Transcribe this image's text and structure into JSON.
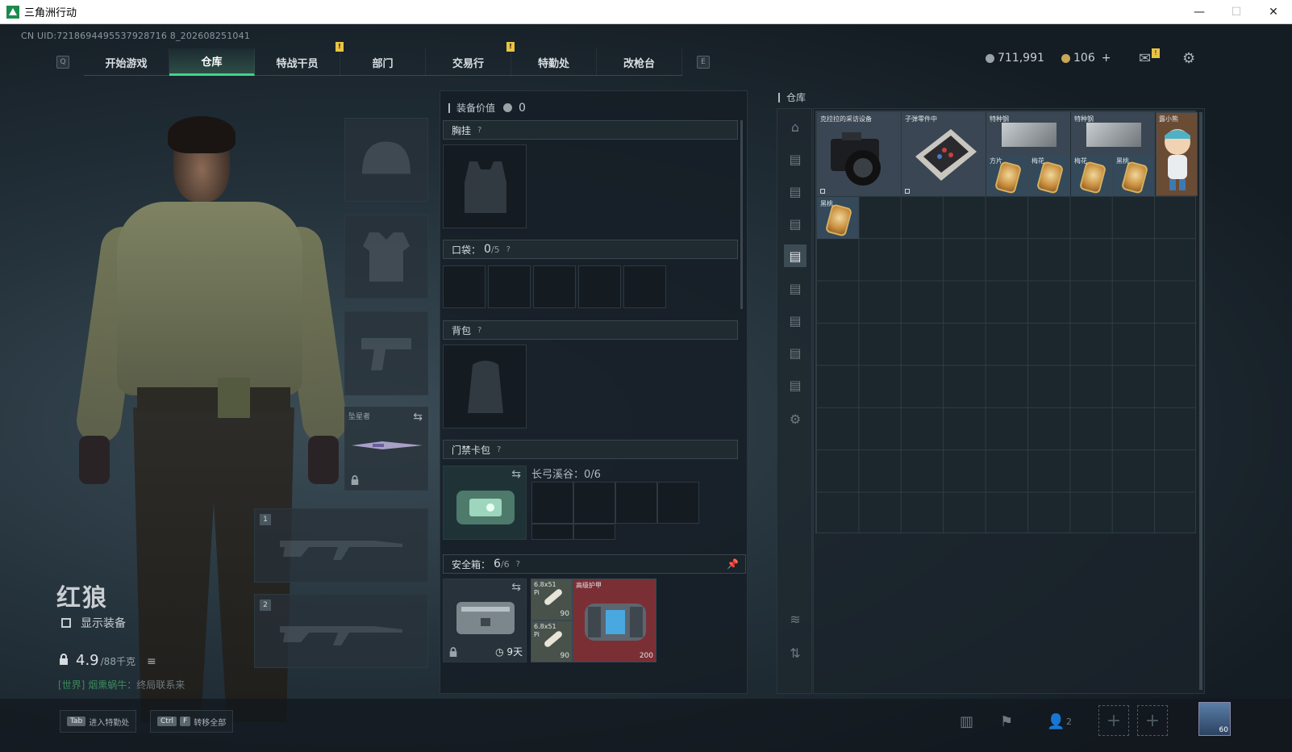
{
  "window": {
    "title": "三角洲行动",
    "min": "—",
    "max": "☐",
    "close": "✕"
  },
  "uid": "CN UID:7218694495537928716 8_202608251041",
  "nav": {
    "left_key": "Q",
    "right_key": "E",
    "tabs": [
      {
        "label": "开始游戏"
      },
      {
        "label": "仓库",
        "active": true
      },
      {
        "label": "特战干员"
      },
      {
        "label": "部门",
        "alert": "!"
      },
      {
        "label": "交易行"
      },
      {
        "label": "特勤处",
        "alert": "!"
      },
      {
        "label": "改枪台"
      }
    ]
  },
  "currency": {
    "silver": "711,991",
    "gold": "106",
    "plus": "+"
  },
  "top_icons": {
    "mail_alert": "!",
    "mail": "mail-icon",
    "settings": "gear-icon"
  },
  "operator": {
    "name": "红狼",
    "show_gear_label": "显示装备",
    "weight": "4.9",
    "weight_max": "/88千克",
    "chat_channel": "[世界]",
    "chat_user": "烟熏蜗牛",
    "chat_text": "：终局联系来"
  },
  "equip_slots": {
    "melee_label": "坠星者",
    "primary_num": "1",
    "secondary_num": "2"
  },
  "loadout": {
    "value_label": "装备价值",
    "value": "0",
    "chest_rig": "胸挂",
    "pockets_label": "口袋：",
    "pockets_count": "0",
    "pockets_cap": "/5",
    "backpack": "背包",
    "keycard": "门禁卡包",
    "keycard_map": "长弓溪谷：0/6",
    "safebox_label": "安全箱：",
    "safebox_count": "6",
    "safebox_cap": "/6",
    "safebox_timer": "9天",
    "ammo1_name": "6.8x51",
    "ammo1_sub": "Pi",
    "ammo1_qty": "90",
    "ammo2_name": "6.8x51",
    "ammo2_sub": "Pi",
    "ammo2_qty": "90",
    "armor_name": "高级护甲",
    "armor_value": "200",
    "help": "?"
  },
  "stash": {
    "title": "仓库",
    "items": {
      "camera": "克拉拉的采访设备",
      "parts": "子弹零件中",
      "plate1": "特种钢",
      "plate2": "特种钢",
      "doll": "露小熊",
      "card1": "方片",
      "card2": "梅花",
      "card3": "梅花",
      "card4": "黑桃",
      "card5": "黑桃"
    }
  },
  "bottom": {
    "hint1_key": "Tab",
    "hint1_text": "进入特勤处",
    "hint2_key1": "Ctrl",
    "hint2_key2": "F",
    "hint2_text": "转移全部",
    "party_count": "2",
    "avatar_level": "60"
  },
  "colors": {
    "accent": "#3fd58a",
    "alert": "#e9c443",
    "safebox_item_bg": "#7a2f35"
  }
}
